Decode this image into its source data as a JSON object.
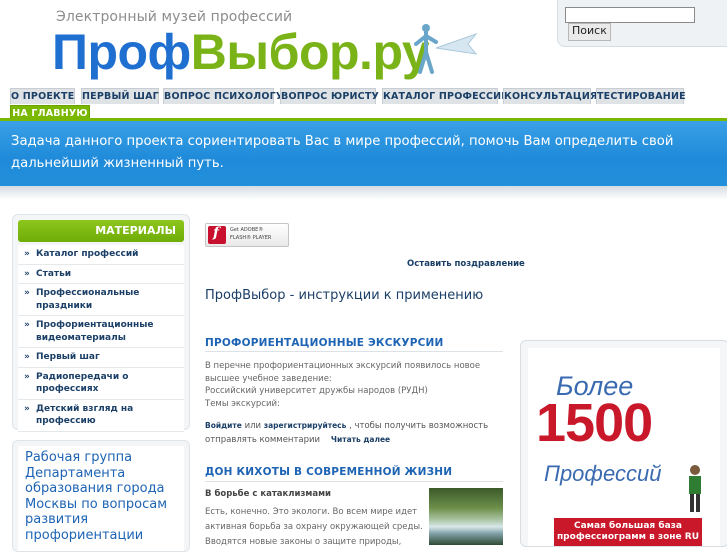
{
  "header": {
    "tagline": "Электронный музей профессий",
    "logo_part1": "Проф",
    "logo_part2": "Выбор.ру"
  },
  "search": {
    "input_value": "",
    "button_label": "Поиск"
  },
  "nav": {
    "items": [
      {
        "label": "О ПРОЕКТЕ"
      },
      {
        "label": "ПЕРВЫЙ ШАГ"
      },
      {
        "label": "ВОПРОС ПСИХОЛОГУ"
      },
      {
        "label": "ВОПРОС ЮРИСТУ"
      },
      {
        "label": "КАТАЛОГ ПРОФЕССИЙ"
      },
      {
        "label": "КОНСУЛЬТАЦИЯ"
      },
      {
        "label": "ТЕСТИРОВАНИЕ"
      },
      {
        "label": "НА ГЛАВНУЮ"
      }
    ],
    "active_color": "#7ab800"
  },
  "banner": {
    "text": "Задача данного проекта сориентировать Вас в мире профессий, помочь Вам определить свой дальнейший жизненный путь."
  },
  "sidebar": {
    "title": "МАТЕРИАЛЫ",
    "items": [
      {
        "label": "Каталог профессий"
      },
      {
        "label": "Статьи"
      },
      {
        "label": "Профессиональные праздники"
      },
      {
        "label": "Профориентационные видеоматериалы"
      },
      {
        "label": "Первый шаг"
      },
      {
        "label": "Радиопередачи о профессиях"
      },
      {
        "label": "Детский взгляд на профессию"
      }
    ]
  },
  "sidebar2": {
    "text": "Рабочая группа Департамента образования города Москвы по вопросам развития профориентации"
  },
  "flash": {
    "line1": "Get ADOBE®",
    "line2": "FLASH® PLAYER"
  },
  "main": {
    "congrats_link": "Оставить поздравление",
    "heading": "ПрофВыбор - инструкции к применению",
    "excursions": {
      "title": "ПРОФОРИЕНТАЦИОННЫЕ ЭКСКУРСИИ",
      "line1": "В перечне профориентационных экскурсий появилось новое",
      "line2": "высшее учебное заведение:",
      "line3": "Российский университет дружбы народов (РУДН)",
      "line4": "Темы экскурсий:",
      "login": "Войдите",
      "or": "или",
      "register": "зарегистрируйтесь",
      "after": ", чтобы получить возможность отправлять комментарии",
      "read_more": "Читать далее"
    },
    "donquixote": {
      "title": "ДОН КИХОТЫ В СОВРЕМЕННОЙ ЖИЗНИ",
      "subtitle": "В борьбе с катаклизмами",
      "text": "Есть, конечно. Это экологи. Во всем мире идет активная борьба за охрану окружающей среды. Вводятся новые законы о защите природы,"
    }
  },
  "ad": {
    "line1": "Более",
    "number": "1500",
    "line3": "Профессий",
    "bottom": "Самая большая база профессиограмм в зоне RU"
  }
}
